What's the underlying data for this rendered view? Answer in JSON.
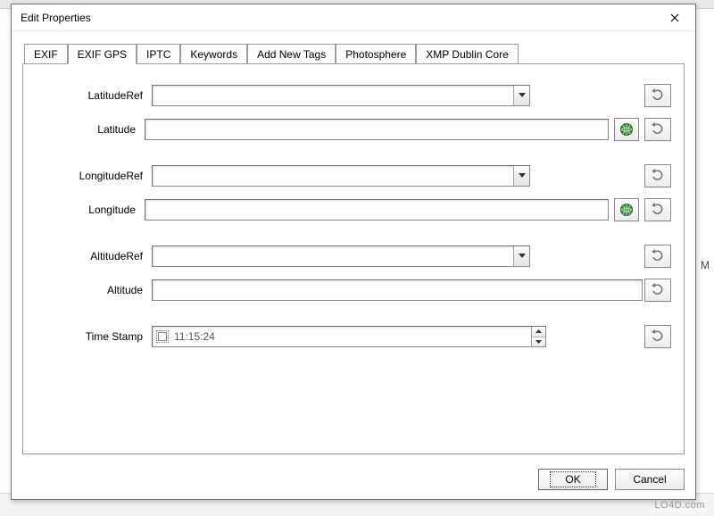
{
  "window": {
    "title": "Edit Properties"
  },
  "tabs": [
    {
      "label": "EXIF"
    },
    {
      "label": "EXIF GPS"
    },
    {
      "label": "IPTC"
    },
    {
      "label": "Keywords"
    },
    {
      "label": "Add New Tags"
    },
    {
      "label": "Photosphere"
    },
    {
      "label": "XMP Dublin Core"
    }
  ],
  "active_tab": 1,
  "fields": {
    "latitude_ref": {
      "label": "LatitudeRef",
      "value": ""
    },
    "latitude": {
      "label": "Latitude",
      "value": ""
    },
    "longitude_ref": {
      "label": "LongitudeRef",
      "value": ""
    },
    "longitude": {
      "label": "Longitude",
      "value": ""
    },
    "altitude_ref": {
      "label": "AltitudeRef",
      "value": ""
    },
    "altitude": {
      "label": "Altitude",
      "value": ""
    },
    "time_stamp": {
      "label": "Time Stamp",
      "value": "11:15:24",
      "checked": false
    }
  },
  "buttons": {
    "ok": "OK",
    "cancel": "Cancel"
  },
  "watermark": "LO4D.com",
  "bg_marker": "M"
}
